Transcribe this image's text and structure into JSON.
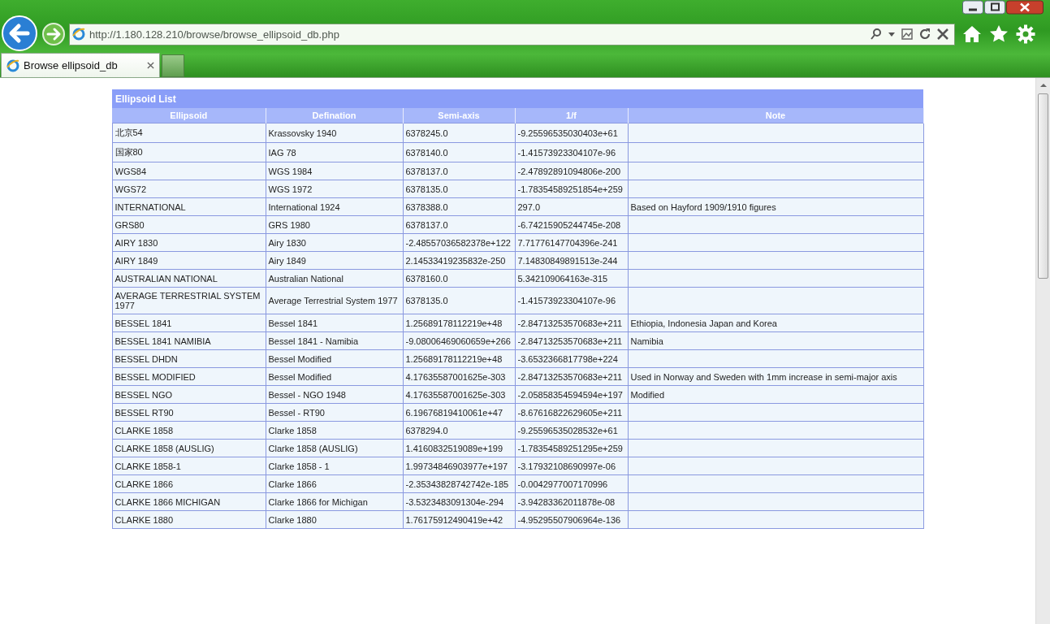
{
  "browser": {
    "url": "http://1.180.128.210/browse/browse_ellipsoid_db.php",
    "tab_title": "Browse ellipsoid_db"
  },
  "table": {
    "title": "Ellipsoid List",
    "columns": [
      "Ellipsoid",
      "Defination",
      "Semi-axis",
      "1/f",
      "Note"
    ],
    "rows": [
      {
        "ellipsoid": "北京54",
        "defination": "Krassovsky 1940",
        "semi_axis": "6378245.0",
        "inv_f": "-9.25596535030403e+61"
      },
      {
        "ellipsoid": "国家80",
        "defination": "IAG 78",
        "semi_axis": "6378140.0",
        "inv_f": "-1.41573923304107e-96"
      },
      {
        "ellipsoid": "WGS84",
        "defination": "WGS 1984",
        "semi_axis": "6378137.0",
        "inv_f": "-2.47892891094806e-200"
      },
      {
        "ellipsoid": "WGS72",
        "defination": "WGS 1972",
        "semi_axis": "6378135.0",
        "inv_f": "-1.78354589251854e+259"
      },
      {
        "ellipsoid": "INTERNATIONAL",
        "defination": "International 1924",
        "semi_axis": "6378388.0",
        "inv_f": "297.0",
        "note": "Based on Hayford 1909/1910 figures"
      },
      {
        "ellipsoid": "GRS80",
        "defination": "GRS 1980",
        "semi_axis": "6378137.0",
        "inv_f": "-6.74215905244745e-208"
      },
      {
        "ellipsoid": "AIRY 1830",
        "defination": "Airy 1830",
        "semi_axis": "-2.48557036582378e+122",
        "inv_f": "7.71776147704396e-241"
      },
      {
        "ellipsoid": "AIRY 1849",
        "defination": "Airy 1849",
        "semi_axis": "2.14533419235832e-250",
        "inv_f": "7.14830849891513e-244"
      },
      {
        "ellipsoid": "AUSTRALIAN NATIONAL",
        "defination": "Australian National",
        "semi_axis": "6378160.0",
        "inv_f": "5.342109064163e-315"
      },
      {
        "ellipsoid": "AVERAGE TERRESTRIAL SYSTEM 1977",
        "defination": "Average Terrestrial System 1977",
        "semi_axis": "6378135.0",
        "inv_f": "-1.41573923304107e-96"
      },
      {
        "ellipsoid": "BESSEL 1841",
        "defination": "Bessel 1841",
        "semi_axis": "1.25689178112219e+48",
        "inv_f": "-2.84713253570683e+211",
        "note": "Ethiopia, Indonesia Japan and Korea"
      },
      {
        "ellipsoid": "BESSEL 1841 NAMIBIA",
        "defination": "Bessel 1841 - Namibia",
        "semi_axis": "-9.08006469060659e+266",
        "inv_f": "-2.84713253570683e+211",
        "note": "Namibia"
      },
      {
        "ellipsoid": "BESSEL DHDN",
        "defination": "Bessel Modified",
        "semi_axis": "1.25689178112219e+48",
        "inv_f": "-3.6532366817798e+224"
      },
      {
        "ellipsoid": "BESSEL MODIFIED",
        "defination": "Bessel Modified",
        "semi_axis": "4.17635587001625e-303",
        "inv_f": "-2.84713253570683e+211",
        "note": "Used in Norway and Sweden with 1mm increase in semi-major axis"
      },
      {
        "ellipsoid": "BESSEL NGO",
        "defination": "Bessel - NGO 1948",
        "semi_axis": "4.17635587001625e-303",
        "inv_f": "-2.05858354594594e+197",
        "note": "Modified"
      },
      {
        "ellipsoid": "BESSEL RT90",
        "defination": "Bessel - RT90",
        "semi_axis": "6.19676819410061e+47",
        "inv_f": "-8.67616822629605e+211"
      },
      {
        "ellipsoid": "CLARKE 1858",
        "defination": "Clarke 1858",
        "semi_axis": "6378294.0",
        "inv_f": "-9.25596535028532e+61"
      },
      {
        "ellipsoid": "CLARKE 1858 (AUSLIG)",
        "defination": "Clarke 1858 (AUSLIG)",
        "semi_axis": "1.4160832519089e+199",
        "inv_f": "-1.78354589251295e+259"
      },
      {
        "ellipsoid": "CLARKE 1858-1",
        "defination": "Clarke 1858 - 1",
        "semi_axis": "1.99734846903977e+197",
        "inv_f": "-3.17932108690997e-06"
      },
      {
        "ellipsoid": "CLARKE 1866",
        "defination": "Clarke 1866",
        "semi_axis": "-2.35343828742742e-185",
        "inv_f": "-0.0042977007170996"
      },
      {
        "ellipsoid": "CLARKE 1866 MICHIGAN",
        "defination": "Clarke 1866 for Michigan",
        "semi_axis": "-3.5323483091304e-294",
        "inv_f": "-3.94283362011878e-08"
      },
      {
        "ellipsoid": "CLARKE 1880",
        "defination": "Clarke 1880",
        "semi_axis": "1.76175912490419e+42",
        "inv_f": "-4.95295507906964e-136"
      }
    ]
  }
}
